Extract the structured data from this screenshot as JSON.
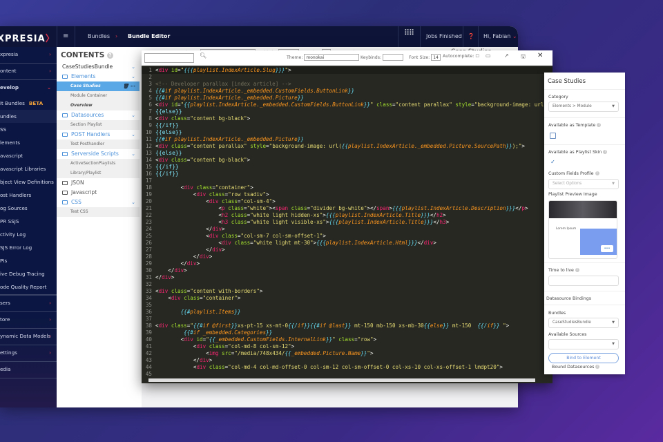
{
  "topbar": {
    "logo": "XPRESIA",
    "breadcrumb": [
      "Bundles",
      "Bundle Editor"
    ],
    "jobs": "Jobs Finished",
    "user": "Hi, Fabian"
  },
  "sidebar": {
    "sections": [
      {
        "label": "xpresia"
      },
      {
        "label": "ontent"
      },
      {
        "label": "evelop"
      }
    ],
    "develop_items": [
      {
        "label": "it Bundles",
        "badge": "BETA"
      },
      {
        "label": "undles"
      },
      {
        "label": "SS"
      },
      {
        "label": "lements"
      },
      {
        "label": "avascript"
      },
      {
        "label": "avascript Libraries"
      },
      {
        "label": "bject View Definitions"
      },
      {
        "label": "ost Handlers"
      },
      {
        "label": "og Sources"
      },
      {
        "label": "PR SSJS"
      },
      {
        "label": "ctivity Log"
      },
      {
        "label": "SJS Error Log"
      },
      {
        "label": "PIs"
      },
      {
        "label": "ive Debug Tracing"
      },
      {
        "label": "ode Quality Report"
      }
    ],
    "bottom_sections": [
      {
        "label": "sers"
      },
      {
        "label": "tore"
      },
      {
        "label": "ynamic Data Models"
      },
      {
        "label": "ettings"
      },
      {
        "label": "edia"
      }
    ]
  },
  "contents": {
    "title": "CONTENTS",
    "bundle": "CaseStudiesBundle",
    "tree": [
      {
        "type": "f",
        "label": "Elements",
        "open": true
      },
      {
        "type": "c",
        "label": "Case Studies",
        "active": true
      },
      {
        "type": "c",
        "label": "Module Container"
      },
      {
        "type": "c",
        "label": "Overview"
      },
      {
        "type": "f",
        "label": "Datasources",
        "open": true
      },
      {
        "type": "c",
        "label": "Section Playlist"
      },
      {
        "type": "f",
        "label": "POST Handlers",
        "open": true
      },
      {
        "type": "c",
        "label": "Test Posthandler"
      },
      {
        "type": "f",
        "label": "Serverside Scripts",
        "open": true
      },
      {
        "type": "c",
        "label": "ActiveSectionPlaylists"
      },
      {
        "type": "c",
        "label": "Library/Playlist"
      },
      {
        "type": "g",
        "label": "JSON"
      },
      {
        "type": "g",
        "label": "Javascript"
      },
      {
        "type": "f",
        "label": "CSS",
        "open": true
      },
      {
        "type": "c",
        "label": "Test CSS"
      }
    ]
  },
  "editor": {
    "search_value": "",
    "theme_label": "Theme:",
    "theme": "monokai",
    "keybinds_label": "Keybinds:",
    "keybinds": "",
    "fontsize_label": "Font Size:",
    "fontsize": "14",
    "autocomplete_label": "Autocomplete:",
    "lines": [
      "<div id=\"{{{playlist.IndexArticle.Slug}}}\">",
      "",
      "<!-- Developer parallax [index article] -->",
      "{{#if playlist.IndexArticle._embedded.CustomFields.ButtonLink}}",
      "{{#if playlist.IndexArticle._embedded.Picture}}",
      "<div id=\"{{playlist.IndexArticle._embedded.CustomFields.ButtonLink}}\" class=\"content parallax\" style=\"background-image: url",
      "{{else}}",
      "<div class=\"content bg-black\">",
      "{{/if}}",
      "{{else}}",
      "{{#if playlist.IndexArticle._embedded.Picture}}",
      "<div class=\"content parallax\" style=\"background-image: url({{playlist.IndexArticle._embedded.Picture.SourcePath}});\">",
      "{{else}}",
      "<div class=\"content bg-black\">",
      "{{/if}}",
      "{{/if}}",
      "",
      "        <div class=\"container\">",
      "            <div class=\"row tsadiv\">",
      "                <div class=\"col-sm-4\">",
      "                    <p class=\"white\"><span class=\"divider bg-white\"></span>{{{playlist.IndexArticle.Description}}}</p>",
      "                    <h2 class=\"white light hidden-xs\">{{{playlist.IndexArticle.Title}}}</h2>",
      "                    <h3 class=\"white light visible-xs\">{{{playlist.IndexArticle.Title}}}</h3>",
      "                </div>",
      "                <div class=\"col-sm-7 col-sm-offset-1\">",
      "                    <div class=\"white light mt-30\">{{{playlist.IndexArticle.Html}}}</div>",
      "                </div>",
      "            </div>",
      "        </div>",
      "    </div>",
      "</div>",
      "",
      "<div class=\"content with-borders\">",
      "    <div class=\"container\">",
      "",
      "        {{#playlist.Items}}",
      "",
      "<div class=\"{{#if @first}}xs-pt-15 xs-mt-0{{/if}}{{#if @last}} mt-150 mb-150 xs-mb-30{{else}} mt-150  {{/if}} \">",
      "         {{#if _embedded.Categories}}",
      "        <div id=\"{{_embedded.CustomFields.InternalLink}}\" class=\"row\">",
      "            <div class=\"col-md-8 col-sm-12\">",
      "                <img src=\"/media/748x434/{{_embedded.Picture.Name}}\">",
      "            </div>",
      "            <div class=\"col-md-4 col-md-offset-0 col-sm-12 col-sm-offset-0 col-xs-10 col-xs-offset-1 lmdpt20\">",
      ""
    ]
  },
  "panel": {
    "title": "Case Studies",
    "category_label": "Category",
    "category": "Elements > Module",
    "template_label": "Available as Template",
    "template_checked": false,
    "skin_label": "Available as Playlist Skin",
    "skin_checked": true,
    "cf_label": "Custom Fields Profile",
    "cf_placeholder": "Select Options",
    "preview_label": "Playlist Preview Image",
    "preview_more": "•••",
    "ttl_label": "Time to live",
    "ttl": "",
    "bindings_label": "Datasource Bindings",
    "bundles_label": "Bundles",
    "bundles": "CaseStudiesBundle",
    "sources_label": "Available Sources",
    "sources": "",
    "bind_button": "Bind to Element",
    "bound_label": "Bound Datasources",
    "preview_text": "Lorem Ipsum"
  },
  "colors": {
    "accent": "#e0324b",
    "link": "#4a90d9",
    "editor_bg": "#272822"
  }
}
